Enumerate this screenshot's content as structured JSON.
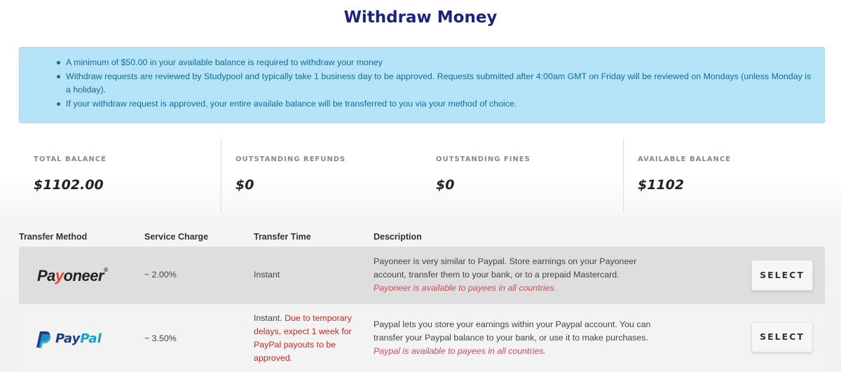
{
  "page": {
    "title": "Withdraw Money"
  },
  "info": {
    "items": [
      "A minimum of $50.00 in your available balance is required to withdraw your money",
      "Withdraw requests are reviewed by Studypool and typically take 1 business day to be approved. Requests submitted after 4:00am GMT on Friday will be reviewed on Mondays (unless Monday is a holiday).",
      "If your withdraw request is approved, your entire availale balance will be transferred to you via your method of choice."
    ]
  },
  "stats": [
    {
      "label": "TOTAL BALANCE",
      "value": "$1102.00"
    },
    {
      "label": "OUTSTANDING REFUNDS",
      "value": "$0"
    },
    {
      "label": "OUTSTANDING FINES",
      "value": "$0"
    },
    {
      "label": "AVAILABLE BALANCE",
      "value": "$1102"
    }
  ],
  "table": {
    "headers": {
      "method": "Transfer Method",
      "charge": "Service Charge",
      "time": "Transfer Time",
      "description": "Description"
    },
    "rows": [
      {
        "logo_text_a": "Pa",
        "logo_text_b": "y",
        "logo_text_c": "oneer",
        "logo_text_d": "®",
        "charge": "~ 2.00%",
        "time": "Instant",
        "time_note": "",
        "description": "Payoneer is very similar to Paypal. Store earnings on your Payoneer account, transfer them to your bank, or to a prepaid Mastercard.",
        "availability": "Payoneer is available to payees in all countries.",
        "button": "SELECT"
      },
      {
        "logo_text_a": "Pay",
        "logo_text_b": "Pal",
        "charge": "~ 3.50%",
        "time": "Instant.",
        "time_note": "Due to temporary delays, expect 1 week for PayPal payouts to be approved.",
        "description": "Paypal lets you store your earnings within your Paypal account. You can transfer your Paypal balance to your bank, or use it to make purchases.",
        "availability": "Paypal is available to payees in all countries.",
        "button": "SELECT"
      }
    ]
  },
  "colors": {
    "title": "#1a237e",
    "info_bg": "#b5e3f8",
    "info_text": "#116e93",
    "availability_text": "#d14a55",
    "delay_text": "#c62828",
    "paypal_dark": "#253b80",
    "paypal_light": "#179bd7",
    "payoneer_accent": "#e8452c"
  },
  "icons": {
    "payoneer": "payoneer-logo",
    "paypal": "paypal-logo"
  }
}
